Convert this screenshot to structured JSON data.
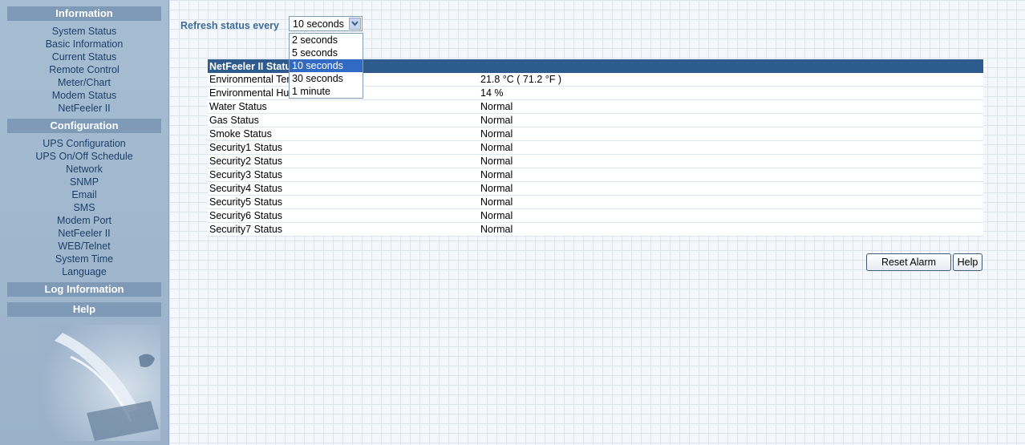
{
  "sidebar": {
    "information": {
      "heading": "Information",
      "items": [
        "System Status",
        "Basic Information",
        "Current Status",
        "Remote Control",
        "Meter/Chart",
        "Modem Status",
        "NetFeeler II"
      ]
    },
    "configuration": {
      "heading": "Configuration",
      "items": [
        "UPS Configuration",
        "UPS On/Off Schedule",
        "Network",
        "SNMP",
        "Email",
        "SMS",
        "Modem Port",
        "NetFeeler II",
        "WEB/Telnet",
        "System Time",
        "Language"
      ]
    },
    "log": {
      "heading": "Log Information"
    },
    "help": {
      "heading": "Help"
    }
  },
  "refresh": {
    "label": "Refresh status every",
    "selected": "10 seconds",
    "options": [
      "2 seconds",
      "5 seconds",
      "10 seconds",
      "30 seconds",
      "1 minute"
    ]
  },
  "table": {
    "header": "NetFeeler II Status",
    "rows": [
      {
        "name": "Environmental Temperature",
        "value": "21.8 °C ( 71.2 °F )"
      },
      {
        "name": "Environmental Humidity",
        "value": "14 %"
      },
      {
        "name": "Water Status",
        "value": "Normal"
      },
      {
        "name": "Gas Status",
        "value": "Normal"
      },
      {
        "name": "Smoke Status",
        "value": "Normal"
      },
      {
        "name": "Security1 Status",
        "value": "Normal"
      },
      {
        "name": "Security2 Status",
        "value": "Normal"
      },
      {
        "name": "Security3 Status",
        "value": "Normal"
      },
      {
        "name": "Security4 Status",
        "value": "Normal"
      },
      {
        "name": "Security5 Status",
        "value": "Normal"
      },
      {
        "name": "Security6 Status",
        "value": "Normal"
      },
      {
        "name": "Security7 Status",
        "value": "Normal"
      }
    ]
  },
  "buttons": {
    "reset_alarm": "Reset Alarm",
    "help": "Help"
  },
  "colors": {
    "sidebar_bg": "#9fb6cd",
    "section_head": "#7f9ab6",
    "table_header": "#2e5b8e",
    "selected_option": "#316ac5"
  }
}
